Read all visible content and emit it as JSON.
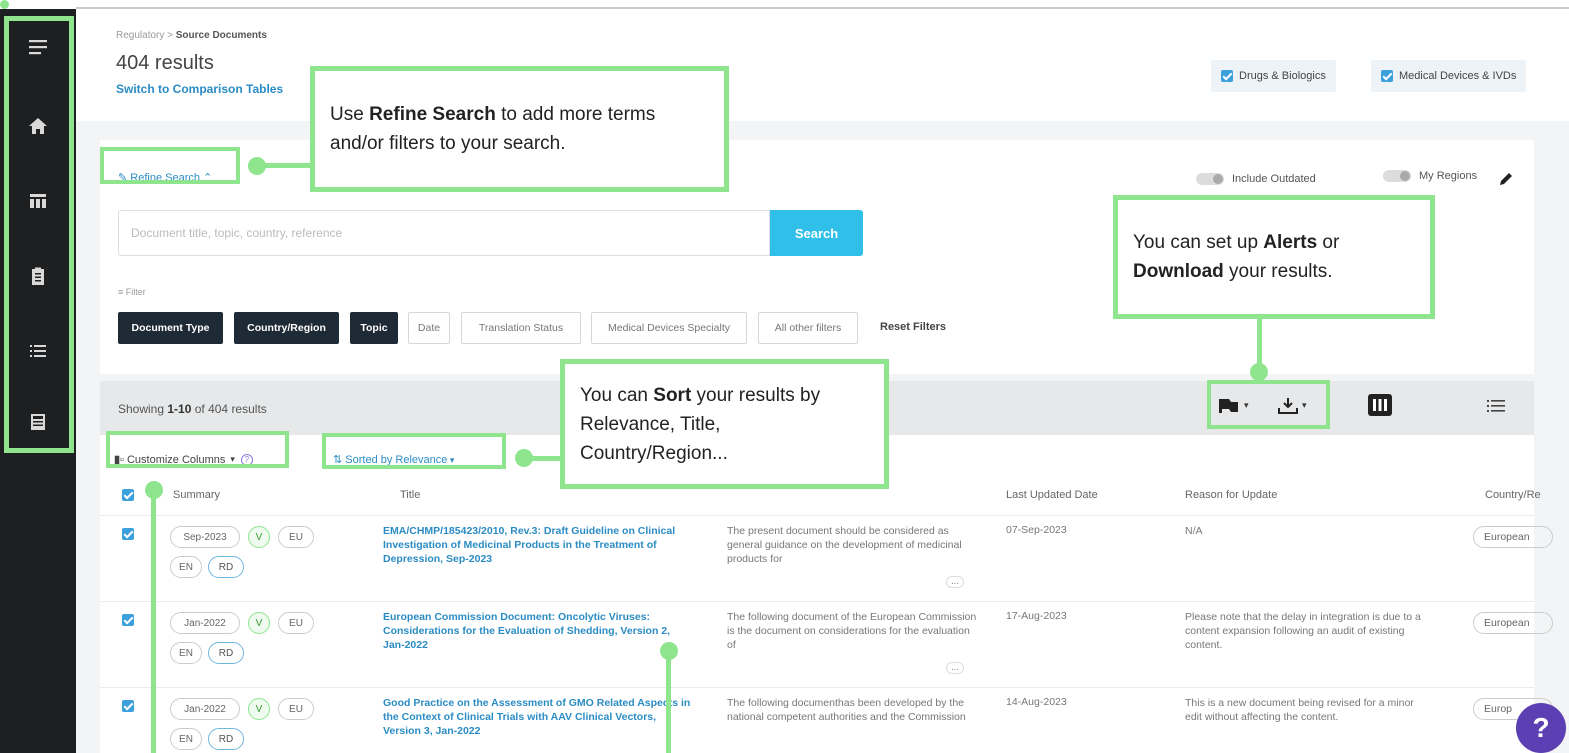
{
  "sidebar": {
    "items": [
      {
        "icon": "menu-icon"
      },
      {
        "icon": "home-icon"
      },
      {
        "icon": "table-icon"
      },
      {
        "icon": "clipboard-icon"
      },
      {
        "icon": "list-icon"
      },
      {
        "icon": "news-icon"
      }
    ]
  },
  "header": {
    "breadcrumb_root": "Regulatory",
    "breadcrumb_sep": " > ",
    "breadcrumb_current": "Source Documents",
    "result_count": "404 results",
    "switch_link": "Switch to Comparison Tables",
    "categories": [
      "Drugs & Biologics",
      "Medical Devices & IVDs"
    ]
  },
  "search": {
    "refine_label": "Refine Search",
    "include_outdated": "Include Outdated",
    "my_regions": "My Regions",
    "placeholder": "Document title, topic, country, reference",
    "search_button": "Search",
    "filter_label": "Filter",
    "filters": [
      {
        "label": "Document Type",
        "active": true
      },
      {
        "label": "Country/Region",
        "active": true
      },
      {
        "label": "Topic",
        "active": true
      },
      {
        "label": "Date",
        "active": false
      },
      {
        "label": "Translation Status",
        "active": false
      },
      {
        "label": "Medical Devices Specialty",
        "active": false
      },
      {
        "label": "All other filters",
        "active": false
      }
    ],
    "reset_filters": "Reset Filters"
  },
  "results": {
    "showing_prefix": "Showing ",
    "showing_range": "1-10",
    "showing_suffix": " of 404 results",
    "customize_columns": "Customize Columns",
    "sorted_by": "Sorted by Relevance",
    "columns": [
      "Summary",
      "Title",
      "Last Updated Date",
      "Reason for Update",
      "Country/Re"
    ],
    "rows": [
      {
        "date_pill": "Sep-2023",
        "v": "V",
        "region": "EU",
        "lang": "EN",
        "rd": "RD",
        "title": "EMA/CHMP/185423/2010, Rev.3: Draft Guideline on Clinical Investigation of Medicinal Products in the Treatment of Depression, Sep-2023",
        "summary": "The present document should be considered as general guidance on the development of medicinal products for",
        "updated": "07-Sep-2023",
        "reason": "N/A",
        "country": "European"
      },
      {
        "date_pill": "Jan-2022",
        "v": "V",
        "region": "EU",
        "lang": "EN",
        "rd": "RD",
        "title": "European Commission Document: Oncolytic Viruses: Considerations for the Evaluation of Shedding, Version 2, Jan-2022",
        "summary": "The following document of the European Commission is the document on considerations for the evaluation of",
        "updated": "17-Aug-2023",
        "reason": "Please note that the delay in integration is due to a content expansion following an audit of existing content.",
        "country": "European"
      },
      {
        "date_pill": "Jan-2022",
        "v": "V",
        "region": "EU",
        "lang": "EN",
        "rd": "RD",
        "title": "Good Practice on the Assessment of GMO Related Aspects in the Context of Clinical Trials with AAV Clinical Vectors, Version 3, Jan-2022",
        "summary": "The following documenthas been developed by the national competent authorities and the Commission",
        "updated": "14-Aug-2023",
        "reason": "This is a new document being revised for a minor edit without affecting the content.",
        "country": "Europ"
      }
    ]
  },
  "callouts": {
    "refine": {
      "pre": "Use ",
      "bold": "Refine Search",
      "post": " to add more terms and/or filters to your search."
    },
    "alerts": {
      "pre": "You can set up ",
      "bold1": "Alerts",
      "mid": " or ",
      "bold2": "Download",
      "post": " your results."
    },
    "sort": {
      "pre": "You can ",
      "bold": "Sort",
      "post": " your results by Relevance, Title, Country/Region..."
    }
  },
  "help_label": "?",
  "colors": {
    "highlight": "#8ee58e",
    "link": "#2b8cc4",
    "search_button": "#2fbfe8",
    "sidebar": "#1d1f21",
    "help": "#5b3fb3"
  }
}
